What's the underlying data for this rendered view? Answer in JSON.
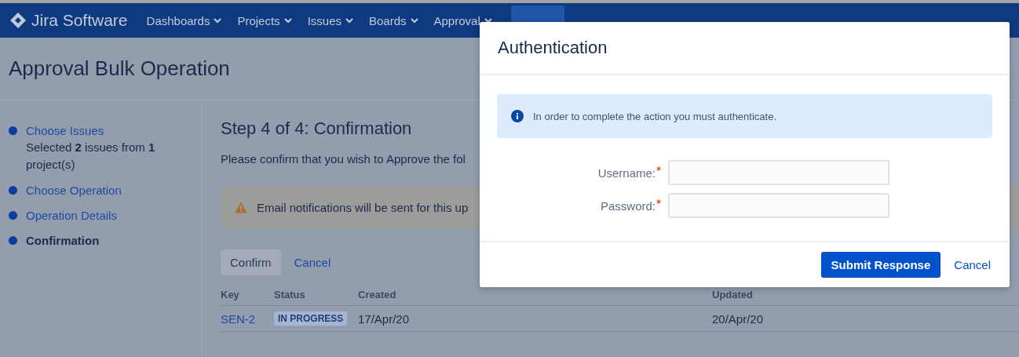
{
  "nav": {
    "product": "Jira Software",
    "items": [
      {
        "label": "Dashboards"
      },
      {
        "label": "Projects"
      },
      {
        "label": "Issues"
      },
      {
        "label": "Boards"
      },
      {
        "label": "Approval"
      }
    ]
  },
  "page": {
    "title": "Approval Bulk Operation",
    "steps": [
      {
        "label": "Choose Issues",
        "selected": false,
        "detail": "Selected **2** issues from **1** project(s)"
      },
      {
        "label": "Choose Operation",
        "selected": false
      },
      {
        "label": "Operation Details",
        "selected": false
      },
      {
        "label": "Confirmation",
        "selected": true
      }
    ],
    "step_title": "Step 4 of 4: Confirmation",
    "intro": "Please confirm that you wish to Approve the fol",
    "warning": "Email notifications will be sent for this up",
    "actions": {
      "confirm": "Confirm",
      "cancel": "Cancel"
    },
    "table": {
      "columns": [
        "Key",
        "Status",
        "Created",
        "Updated"
      ],
      "rows": [
        {
          "key": "SEN-2",
          "status": "IN PROGRESS",
          "created": "17/Apr/20",
          "updated": "20/Apr/20"
        }
      ]
    }
  },
  "modal": {
    "title": "Authentication",
    "info": "In order to complete the action you must authenticate.",
    "fields": [
      {
        "label": "Username:",
        "required": true
      },
      {
        "label": "Password:",
        "required": true
      }
    ],
    "submit": "Submit Response",
    "cancel": "Cancel"
  }
}
